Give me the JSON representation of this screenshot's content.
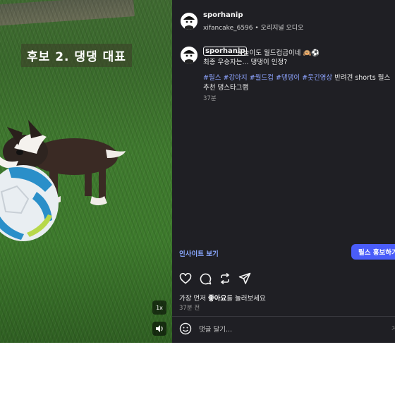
{
  "video": {
    "caption": "후보 2. 댕댕 대표",
    "speed_label": "1x"
  },
  "header": {
    "username": "sporhanip",
    "subline": "xifancake_6596 • 오리지널 오디오"
  },
  "post_caption": {
    "username": "sporhanip",
    "line1": "공놀이도 월드컵급이네 🙉⚽",
    "line2": "최종 우승자는... 댕댕이 인정?",
    "tags": [
      "#릴스",
      "#강아지",
      "#월드컵",
      "#댕댕이",
      "#웃긴영상"
    ],
    "tail_text": "반려견 shorts 릴스추천 댕스타그램",
    "time": "37분"
  },
  "actions": {
    "insights_label": "인사이트 보기",
    "promote_label": "릴스 홍보하기"
  },
  "likes": {
    "prefix": "가장 먼저 ",
    "bold": "좋아요",
    "suffix": "를 눌러보세요"
  },
  "post_time": "37분 전",
  "comment": {
    "placeholder": "댓글 달기...",
    "post_label": "게"
  },
  "colors": {
    "panel_bg": "#1f1f24",
    "tag_blue": "#8ea4ff",
    "promote_bg": "#4a5df9"
  }
}
